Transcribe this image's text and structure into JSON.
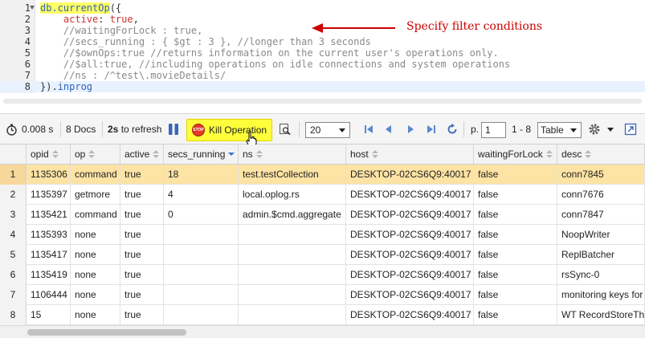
{
  "editor": {
    "lines": [
      {
        "n": "1",
        "parts": [
          {
            "t": "db.currentOp",
            "c": "c-blue hl-yellow"
          },
          {
            "t": "({",
            "c": "c-dark"
          }
        ]
      },
      {
        "n": "2",
        "parts": [
          {
            "t": "    active",
            "c": "c-red"
          },
          {
            "t": ": ",
            "c": "c-dark"
          },
          {
            "t": "true",
            "c": "c-red"
          },
          {
            "t": ",",
            "c": "c-dark"
          }
        ]
      },
      {
        "n": "3",
        "parts": [
          {
            "t": "    //waitingForLock : true,",
            "c": "c-gray"
          }
        ]
      },
      {
        "n": "4",
        "parts": [
          {
            "t": "    //secs_running : { $gt : 3 }, //longer than 3 seconds",
            "c": "c-gray"
          }
        ]
      },
      {
        "n": "5",
        "parts": [
          {
            "t": "    //$ownOps:true //returns information on the current user's operations only.",
            "c": "c-gray"
          }
        ]
      },
      {
        "n": "6",
        "parts": [
          {
            "t": "    //$all:true, //including operations on idle connections and system operations",
            "c": "c-gray"
          }
        ]
      },
      {
        "n": "7",
        "parts": [
          {
            "t": "    //ns : /^test\\.movieDetails/",
            "c": "c-gray"
          }
        ]
      },
      {
        "n": "8",
        "parts": [
          {
            "t": "}).",
            "c": "c-dark"
          },
          {
            "t": "inprog",
            "c": "c-blue"
          }
        ]
      }
    ]
  },
  "annotation": {
    "text": "Specify filter conditions",
    "color": "#cc0000"
  },
  "toolbar": {
    "time": "0.008 s",
    "docs": "8 Docs",
    "refresh_interval": "2s",
    "refresh_suffix": " to refresh",
    "kill_label": "Kill Operation",
    "kill_icon_text": "STOP",
    "page_size": "20",
    "page_prefix": "p.",
    "page_number": "1",
    "range": "1 - 8",
    "view_mode": "Table"
  },
  "grid": {
    "columns": [
      {
        "key": "num",
        "label": "",
        "w": 33
      },
      {
        "key": "opid",
        "label": "opid",
        "w": 55,
        "sort": "none"
      },
      {
        "key": "op",
        "label": "op",
        "w": 62,
        "sort": "none"
      },
      {
        "key": "active",
        "label": "active",
        "w": 54,
        "sort": "none"
      },
      {
        "key": "secs_running",
        "label": "secs_running",
        "w": 93,
        "sort": "desc"
      },
      {
        "key": "ns",
        "label": "ns",
        "w": 134,
        "sort": "none"
      },
      {
        "key": "host",
        "label": "host",
        "w": 159,
        "sort": "none"
      },
      {
        "key": "waitingForLock",
        "label": "waitingForLock",
        "w": 104,
        "sort": "none"
      },
      {
        "key": "desc",
        "label": "desc",
        "w": 109,
        "sort": "none"
      }
    ],
    "rows": [
      {
        "num": "1",
        "opid": "1135306",
        "op": "command",
        "active": "true",
        "secs_running": "18",
        "ns": "test.testCollection",
        "host": "DESKTOP-02CS6Q9:40017",
        "waitingForLock": "false",
        "desc": "conn7845"
      },
      {
        "num": "2",
        "opid": "1135397",
        "op": "getmore",
        "active": "true",
        "secs_running": "4",
        "ns": "local.oplog.rs",
        "host": "DESKTOP-02CS6Q9:40017",
        "waitingForLock": "false",
        "desc": "conn7676"
      },
      {
        "num": "3",
        "opid": "1135421",
        "op": "command",
        "active": "true",
        "secs_running": "0",
        "ns": "admin.$cmd.aggregate",
        "host": "DESKTOP-02CS6Q9:40017",
        "waitingForLock": "false",
        "desc": "conn7847"
      },
      {
        "num": "4",
        "opid": "1135393",
        "op": "none",
        "active": "true",
        "secs_running": "",
        "ns": "",
        "host": "DESKTOP-02CS6Q9:40017",
        "waitingForLock": "false",
        "desc": "NoopWriter"
      },
      {
        "num": "5",
        "opid": "1135417",
        "op": "none",
        "active": "true",
        "secs_running": "",
        "ns": "",
        "host": "DESKTOP-02CS6Q9:40017",
        "waitingForLock": "false",
        "desc": "ReplBatcher"
      },
      {
        "num": "6",
        "opid": "1135419",
        "op": "none",
        "active": "true",
        "secs_running": "",
        "ns": "",
        "host": "DESKTOP-02CS6Q9:40017",
        "waitingForLock": "false",
        "desc": "rsSync-0"
      },
      {
        "num": "7",
        "opid": "1106444",
        "op": "none",
        "active": "true",
        "secs_running": "",
        "ns": "",
        "host": "DESKTOP-02CS6Q9:40017",
        "waitingForLock": "false",
        "desc": "monitoring keys for"
      },
      {
        "num": "8",
        "opid": "15",
        "op": "none",
        "active": "true",
        "secs_running": "",
        "ns": "",
        "host": "DESKTOP-02CS6Q9:40017",
        "waitingForLock": "false",
        "desc": "WT RecordStoreTh"
      }
    ],
    "selected_row": 0
  },
  "colors": {
    "selected_row": "#fde3a4",
    "kill_button": "#ffff3a",
    "accent_blue": "#3c6fd8"
  },
  "icons": [
    "stopwatch-icon",
    "pause-icon",
    "stop-icon",
    "pointer-hand-icon",
    "query-profile-icon",
    "first-page-icon",
    "prev-page-icon",
    "next-page-icon",
    "last-page-icon",
    "refresh-icon",
    "gear-icon",
    "export-icon"
  ]
}
